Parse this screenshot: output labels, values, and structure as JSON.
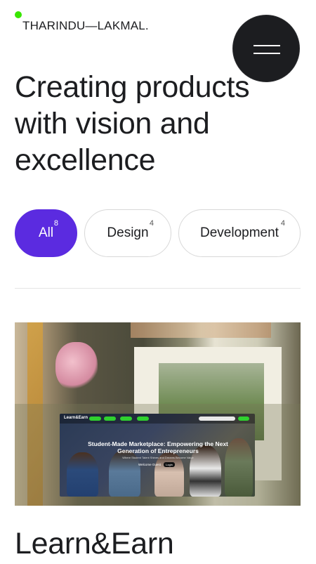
{
  "header": {
    "logo_text": "THARINDU—LAKMAL.",
    "accent_color": "#39e600",
    "menu_icon": "hamburger-icon"
  },
  "hero": {
    "headline": "Creating products with vision and excellence"
  },
  "filters": [
    {
      "label": "All",
      "count": "8",
      "active": true
    },
    {
      "label": "Design",
      "count": "4",
      "active": false
    },
    {
      "label": "Development",
      "count": "4",
      "active": false
    }
  ],
  "colors": {
    "active_pill": "#5b2be0",
    "dark": "#1c1d20"
  },
  "project": {
    "title": "Learn&Earn",
    "preview": {
      "logo": "Learn&Earn",
      "headline": "Student-Made Marketplace: Empowering the Next Generation of Entrepreneurs",
      "subtext": "Where Student Talent Shines and Dreams Become Value",
      "cta_primary": "Welcome Guest",
      "cta_secondary": "Login"
    }
  }
}
